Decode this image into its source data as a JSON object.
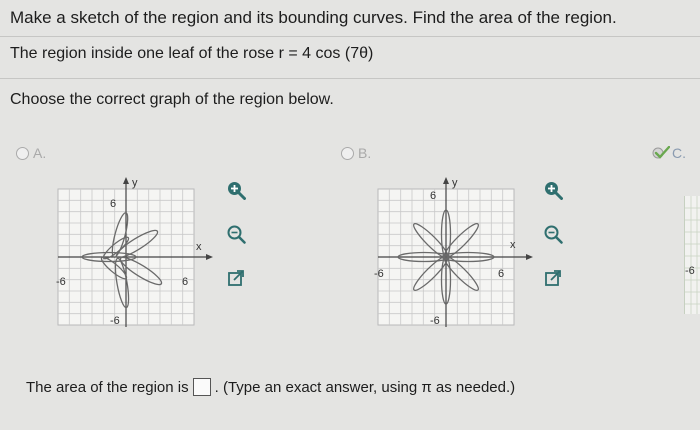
{
  "question": {
    "prompt": "Make a sketch of the region and its bounding curves. Find the area of the region.",
    "region_text": "The region inside one leaf of the rose r = 4 cos (7θ)",
    "choose_text": "Choose the correct graph of the region below."
  },
  "options": [
    {
      "label": "A.",
      "y_axis": "y",
      "x_axis": "x",
      "x_min": "-6",
      "x_max": "6",
      "y_max": "6",
      "y_min": "-6"
    },
    {
      "label": "B.",
      "y_axis": "y",
      "x_axis": "x",
      "x_min": "-6",
      "x_max": "6",
      "y_max": "6",
      "y_min": "-6"
    },
    {
      "label": "C.",
      "x_min": "-6"
    }
  ],
  "answer": {
    "prefix": "The area of the region is",
    "suffix": ". (Type an exact answer, using π as needed.)",
    "value": ""
  },
  "colors": {
    "curve": "#6a6a6a",
    "grid": "#c9c9c9",
    "tool_icon": "#2f6f6f",
    "check": "#6aa84f"
  },
  "icons": [
    "zoom-in-icon",
    "zoom-out-icon",
    "popout-icon",
    "check-icon"
  ]
}
